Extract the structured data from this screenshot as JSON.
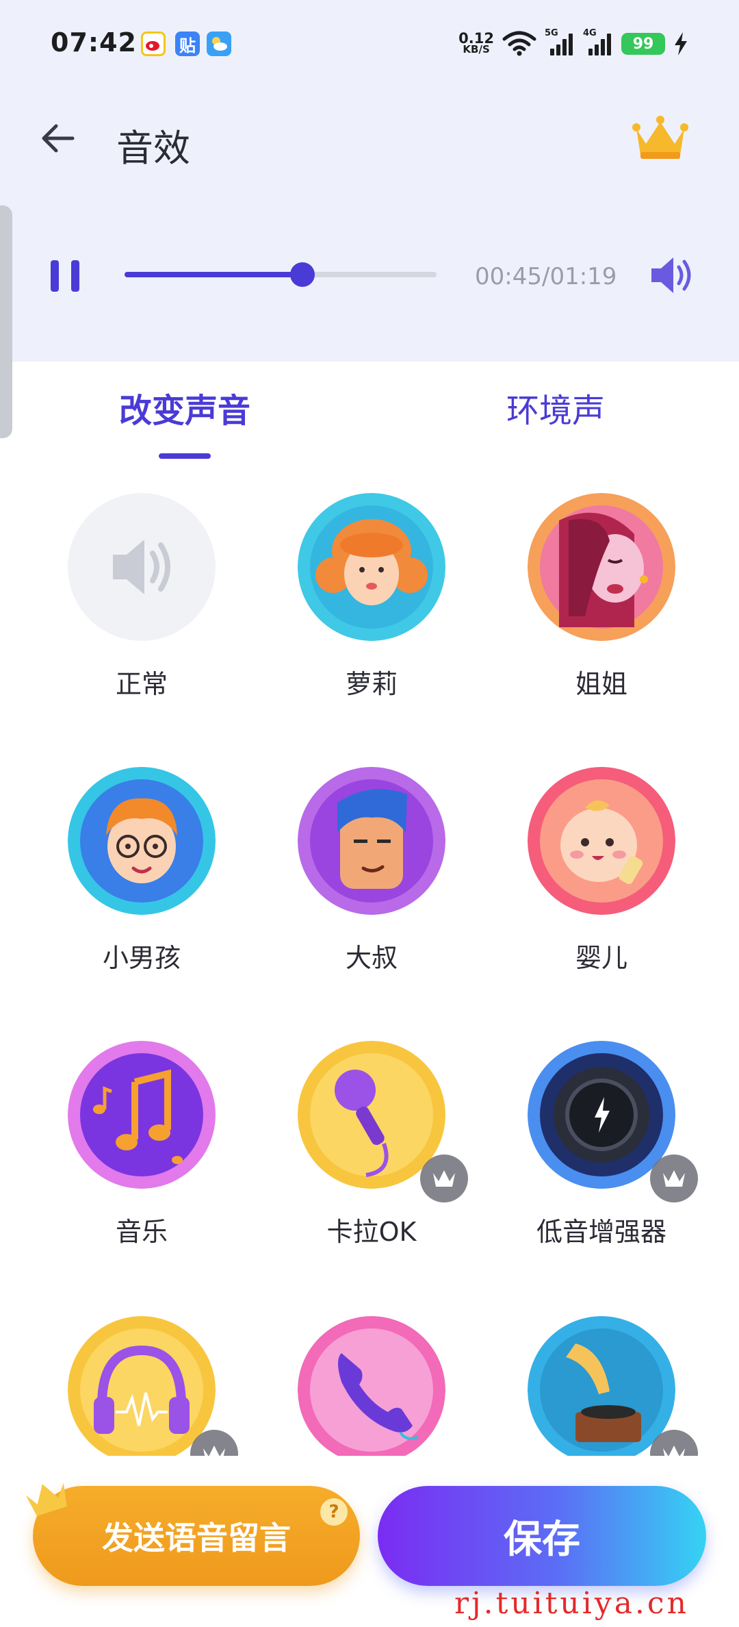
{
  "status_bar": {
    "time": "07:42",
    "net_speed_value": "0.12",
    "net_speed_unit": "KB/S",
    "signal_1_label": "5G",
    "signal_2_label": "4G",
    "battery": "99",
    "icons": [
      "weibo-icon",
      "tieba-icon",
      "weather-icon",
      "wifi-icon",
      "signal-icon",
      "charging-icon"
    ]
  },
  "app_bar": {
    "title": "音效"
  },
  "player": {
    "progress": 0.57,
    "time_text": "00:45/01:19"
  },
  "tabs": [
    {
      "label": "改变声音",
      "active": true
    },
    {
      "label": "环境声",
      "active": false
    }
  ],
  "effects": [
    {
      "label": "正常",
      "vip": false,
      "icon": "speaker-icon"
    },
    {
      "label": "萝莉",
      "vip": false,
      "icon": "girl-avatar"
    },
    {
      "label": "姐姐",
      "vip": false,
      "icon": "woman-avatar"
    },
    {
      "label": "小男孩",
      "vip": false,
      "icon": "boy-avatar"
    },
    {
      "label": "大叔",
      "vip": false,
      "icon": "man-avatar"
    },
    {
      "label": "婴儿",
      "vip": false,
      "icon": "baby-avatar"
    },
    {
      "label": "音乐",
      "vip": false,
      "icon": "music-note-icon"
    },
    {
      "label": "卡拉OK",
      "vip": true,
      "icon": "microphone-icon"
    },
    {
      "label": "低音增强器",
      "vip": true,
      "icon": "bass-knob-icon"
    },
    {
      "label": "",
      "vip": true,
      "icon": "headphones-icon"
    },
    {
      "label": "",
      "vip": false,
      "icon": "phone-icon"
    },
    {
      "label": "",
      "vip": true,
      "icon": "gramophone-icon"
    }
  ],
  "bottom": {
    "send_label": "发送语音留言",
    "help": "?",
    "save_label": "保存"
  },
  "watermark": "rj.tuituiya.cn",
  "colors": {
    "accent": "#4a3bd6",
    "header_bg": "#eef1fb",
    "send_orange": "#f2a223",
    "save_gradient_start": "#7b2cf2",
    "save_gradient_end": "#35d3f3"
  }
}
